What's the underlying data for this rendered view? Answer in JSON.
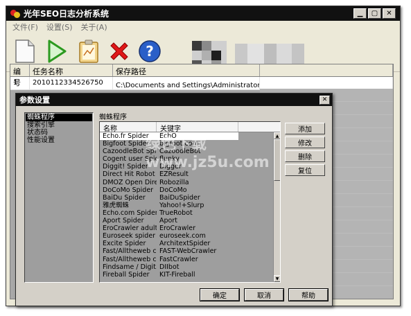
{
  "window": {
    "title": "光年SEO日志分析系统",
    "min_label": "▁",
    "max_label": "▢",
    "close_label": "✕"
  },
  "menu": [
    "文件(F)",
    "设置(S)",
    "关于(A)"
  ],
  "toolbar": [
    "new-icon",
    "play-icon",
    "clipboard-icon",
    "delete-icon",
    "help-icon"
  ],
  "tasklist": {
    "headers": [
      "编号",
      "任务名称",
      "保存路径"
    ],
    "rows": [
      {
        "id": "1",
        "name": "2010112334526750",
        "path": "C:\\Documents and Settings\\Administrator\\桌面\\"
      }
    ]
  },
  "dialog": {
    "title": "参数设置",
    "close_label": "✕",
    "tree": [
      "蜘蛛程序",
      "搜索引擎",
      "状态码",
      "性能设置"
    ],
    "section": "蜘蛛程序",
    "grid_headers": [
      "名称",
      "关键字"
    ],
    "spiders": [
      [
        "Echo.fr Spider",
        "EchO"
      ],
      [
        "Bigfoot Spider",
        "bigfoot.com"
      ],
      [
        "CazoodleBot Spi...",
        "CazoodleBot"
      ],
      [
        "Cogent user Spider",
        "flunky"
      ],
      [
        "Diggit! Spider",
        "Digger"
      ],
      [
        "Direct Hit Robot",
        "EZResult"
      ],
      [
        "DMOZ Open Dire...",
        "Robozilla"
      ],
      [
        "DoCoMo Spider",
        "DoCoMo"
      ],
      [
        "BaiDu Spider",
        "BaiDuSpider"
      ],
      [
        "雅虎蜘蛛",
        "Yahoo!+Slurp"
      ],
      [
        "Echo.com Spider",
        "TrueRobot"
      ],
      [
        "Aport Spider",
        "Aport"
      ],
      [
        "EroCrawler adult...",
        "EroCrawler"
      ],
      [
        "Euroseek spider",
        "euroseek.com"
      ],
      [
        "Excite Spider",
        "ArchitextSpider"
      ],
      [
        "Fast/Alltheweb c...",
        "FAST-WebCrawler"
      ],
      [
        "Fast/Alltheweb c...",
        "FastCrawler"
      ],
      [
        "Findsame / Digit...",
        "DIIbot"
      ],
      [
        "Fireball Spider",
        "KIT-Fireball"
      ]
    ],
    "side_buttons": [
      "添加",
      "修改",
      "删除",
      "复位"
    ],
    "bottom_buttons": [
      "确定",
      "取消",
      "帮助"
    ]
  },
  "watermark": "绿色下载 www.jz5u.com"
}
